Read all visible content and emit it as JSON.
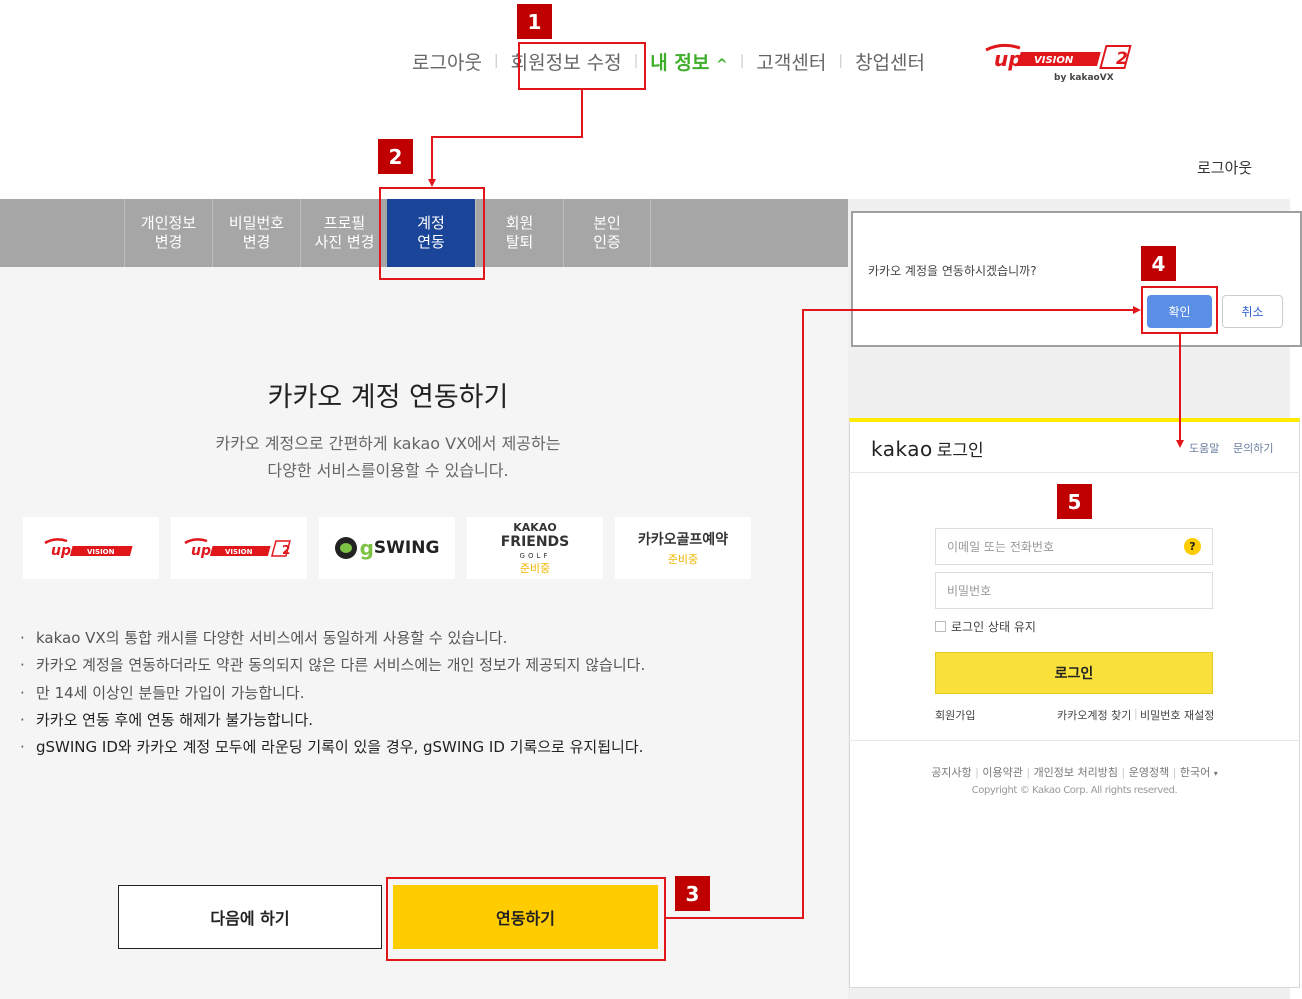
{
  "top_nav": {
    "items": [
      "로그아웃",
      "회원정보 수정",
      "내 정보",
      "고객센터",
      "창업센터"
    ],
    "active_item": "내 정보",
    "active_caret": "^",
    "separator": "|"
  },
  "logo": {
    "brand": "UP VISION 2",
    "sub": "by kakaoVX"
  },
  "logout_link": "로그아웃",
  "sub_tabs": [
    {
      "line1": "개인정보",
      "line2": "변경"
    },
    {
      "line1": "비밀번호",
      "line2": "변경"
    },
    {
      "line1": "프로필",
      "line2": "사진 변경"
    },
    {
      "line1": "계정",
      "line2": "연동"
    },
    {
      "line1": "회원",
      "line2": "탈퇴"
    },
    {
      "line1": "본인",
      "line2": "인증"
    }
  ],
  "main": {
    "title": "카카오 계정 연동하기",
    "desc_line1": "카카오 계정으로 간편하게 kakao VX에서 제공하는",
    "desc_line2": "다양한 서비스를이용할 수 있습니다.",
    "services": [
      {
        "name": "upVISION",
        "note": ""
      },
      {
        "name": "upVISION2",
        "note": ""
      },
      {
        "name": "gSWING",
        "note": ""
      },
      {
        "name": "KAKAO FRIENDS GOLF",
        "note": "준비중"
      },
      {
        "name": "카카오골프예약",
        "note": "준비중"
      }
    ],
    "bullets": [
      "kakao VX의 통합 캐시를 다양한 서비스에서 동일하게 사용할 수 있습니다.",
      "카카오 계정을 연동하더라도 약관 동의되지 않은 다른 서비스에는 개인 정보가 제공되지 않습니다.",
      "만 14세 이상인 분들만 가입이 가능합니다.",
      "카카오 연동 후에 연동 해제가 불가능합니다.",
      "gSWING ID와 카카오 계정 모두에 라운딩 기록이 있을 경우, gSWING ID 기록으로 유지됩니다."
    ],
    "bullet_marker": "·",
    "later_button": "다음에 하기",
    "link_button": "연동하기"
  },
  "dialog": {
    "message": "카카오 계정을 연동하시겠습니까?",
    "ok": "확인",
    "cancel": "취소"
  },
  "kakao_login": {
    "brand": "kakao",
    "title": "로그인",
    "help": "도움말",
    "inquiry": "문의하기",
    "id_placeholder": "이메일 또는 전화번호",
    "pw_placeholder": "비밀번호",
    "help_icon": "?",
    "keep_login": "로그인 상태 유지",
    "login_button": "로그인",
    "signup": "회원가입",
    "find_account": "카카오계정 찾기",
    "reset_password": "비밀번호 재설정",
    "footer_links": [
      "공지사항",
      "이용약관",
      "개인정보 처리방침",
      "운영정책",
      "한국어"
    ],
    "copyright": "Copyright © Kakao Corp. All rights reserved."
  },
  "callouts": [
    "1",
    "2",
    "3",
    "4",
    "5"
  ],
  "colors": {
    "callout_red": "#c00000",
    "outline_red": "#e0161b",
    "active_tab": "#1b4598",
    "link_button": "#ffcc00",
    "kakao_yellow": "#f9e03b",
    "ok_button": "#5b8fe6",
    "active_nav": "#3fae2a"
  }
}
